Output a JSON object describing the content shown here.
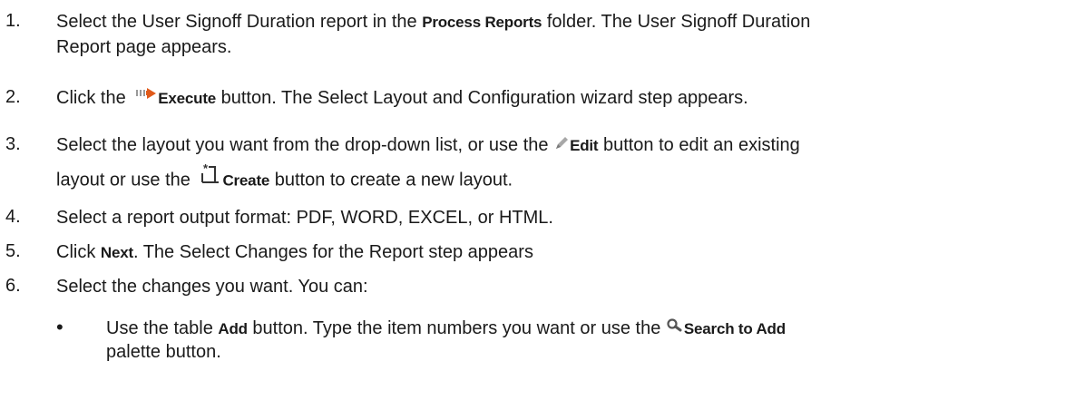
{
  "steps": [
    {
      "num": "1.",
      "line1_pre": "Select the User Signoff Duration report in the ",
      "line1_bold": "Process Reports",
      "line1_post": " folder. The User Signoff Duration",
      "line2": "Report page appears."
    },
    {
      "num": "2.",
      "pre": "Click the ",
      "icon": "execute-icon",
      "bold": "Execute",
      "post": " button. The Select Layout and Configuration wizard step appears."
    },
    {
      "num": "3.",
      "line1_pre": "Select the layout you want from the drop-down list, or use the ",
      "line1_icon": "edit-pencil-icon",
      "line1_bold": "Edit",
      "line1_post": " button to edit an existing",
      "line2_pre": "layout or use the ",
      "line2_icon": "create-new-icon",
      "line2_bold": "Create",
      "line2_post": " button to create a new layout."
    },
    {
      "num": "4.",
      "text": "Select a report output format: PDF, WORD, EXCEL, or HTML."
    },
    {
      "num": "5.",
      "pre": "Click ",
      "bold": "Next",
      "post": ". The Select Changes for the Report step appears"
    },
    {
      "num": "6.",
      "text": "Select the changes you want. You can:"
    }
  ],
  "subitem": {
    "bullet": "•",
    "line1_pre": "Use the table ",
    "line1_bold": "Add",
    "line1_mid": " button. Type the item numbers you want or use the ",
    "line1_icon": "search-icon",
    "line1_bold2": "Search to Add",
    "line2": "palette button."
  }
}
